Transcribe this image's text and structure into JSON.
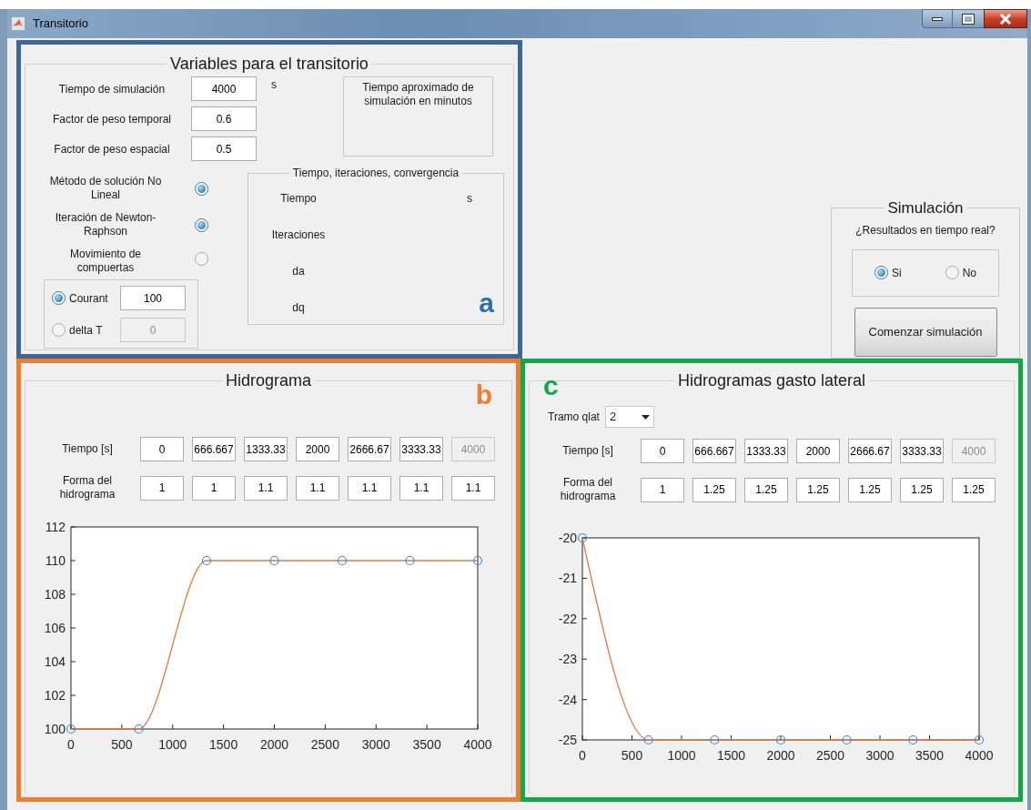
{
  "window": {
    "title": "Transitorio"
  },
  "variables_panel": {
    "title": "Variables para el transitorio",
    "annotation": {
      "letter": "a",
      "color": "#2f6ea8"
    },
    "fields": [
      {
        "label": "Tiempo de simulación",
        "value": "4000",
        "unit": "s"
      },
      {
        "label": "Factor de peso temporal",
        "value": "0.6"
      },
      {
        "label": "Factor de peso espacial",
        "value": "0.5"
      }
    ],
    "approx_time_box": {
      "text": "Tiempo aproximado de simulación en minutos"
    },
    "options": [
      {
        "label": "Método de solución No Lineal",
        "checked": true
      },
      {
        "label": "Iteración de Newton-Raphson",
        "checked": true
      },
      {
        "label": "Movimiento de compuertas",
        "checked": false
      }
    ],
    "step_group": [
      {
        "label": "Courant",
        "selected": true,
        "value": "100",
        "disabled": false
      },
      {
        "label": "delta T",
        "selected": false,
        "value": "0",
        "disabled": true
      }
    ],
    "convergence": {
      "title": "Tiempo, iteraciones, convergencia",
      "rows": [
        {
          "label": "Tiempo",
          "unit": "s"
        },
        {
          "label": "Iteraciones"
        },
        {
          "label": "da"
        },
        {
          "label": "dq"
        }
      ]
    }
  },
  "simulation": {
    "title": "Simulación",
    "question": "¿Resultados en tiempo real?",
    "options": [
      {
        "label": "Si",
        "selected": true
      },
      {
        "label": "No",
        "selected": false
      }
    ],
    "start_button": "Comenzar simulación"
  },
  "hydrograph": {
    "title": "Hidrograma",
    "annotation": {
      "letter": "b",
      "color": "#ed7d31"
    },
    "time_row": {
      "label": "Tiempo [s]",
      "cells": [
        {
          "value": "0",
          "disabled": false
        },
        {
          "value": "666.667",
          "disabled": false
        },
        {
          "value": "1333.33",
          "disabled": false
        },
        {
          "value": "2000",
          "disabled": false
        },
        {
          "value": "2666.67",
          "disabled": false
        },
        {
          "value": "3333.33",
          "disabled": false
        },
        {
          "value": "4000",
          "disabled": true
        }
      ]
    },
    "shape_row": {
      "label": "Forma del hidrograma",
      "cells": [
        {
          "value": "1",
          "disabled": false
        },
        {
          "value": "1",
          "disabled": false
        },
        {
          "value": "1.1",
          "disabled": false
        },
        {
          "value": "1.1",
          "disabled": false
        },
        {
          "value": "1.1",
          "disabled": false
        },
        {
          "value": "1.1",
          "disabled": false
        },
        {
          "value": "1.1",
          "disabled": false
        }
      ]
    },
    "chart_data": {
      "type": "line",
      "x": [
        0,
        666.667,
        1333.33,
        2000,
        2666.67,
        3333.33,
        4000
      ],
      "series": [
        {
          "color": "#e07b45",
          "marker": "o",
          "values": [
            100,
            100,
            110,
            110,
            110,
            110,
            110
          ]
        }
      ],
      "xlim": [
        0,
        4000
      ],
      "ylim": [
        100,
        112
      ],
      "xticks": [
        0,
        500,
        1000,
        1500,
        2000,
        2500,
        3000,
        3500,
        4000
      ],
      "yticks": [
        100,
        102,
        104,
        106,
        108,
        110,
        112
      ]
    }
  },
  "lateral_hydrograph": {
    "title": "Hidrogramas gasto lateral",
    "annotation": {
      "letter": "c",
      "color": "#13a64a"
    },
    "section_select": {
      "label": "Tramo qlat",
      "value": "2"
    },
    "time_row": {
      "label": "Tiempo [s]",
      "cells": [
        {
          "value": "0",
          "disabled": false
        },
        {
          "value": "666.667",
          "disabled": false
        },
        {
          "value": "1333.33",
          "disabled": false
        },
        {
          "value": "2000",
          "disabled": false
        },
        {
          "value": "2666.67",
          "disabled": false
        },
        {
          "value": "3333.33",
          "disabled": false
        },
        {
          "value": "4000",
          "disabled": true
        }
      ]
    },
    "shape_row": {
      "label": "Forma del hidrograma",
      "cells": [
        {
          "value": "1",
          "disabled": false
        },
        {
          "value": "1.25",
          "disabled": false
        },
        {
          "value": "1.25",
          "disabled": false
        },
        {
          "value": "1.25",
          "disabled": false
        },
        {
          "value": "1.25",
          "disabled": false
        },
        {
          "value": "1.25",
          "disabled": false
        },
        {
          "value": "1.25",
          "disabled": false
        }
      ]
    },
    "chart_data": {
      "type": "line",
      "x": [
        0,
        666.667,
        1333.33,
        2000,
        2666.67,
        3333.33,
        4000
      ],
      "series": [
        {
          "color": "#e07b45",
          "marker": "o",
          "values": [
            -20,
            -25,
            -25,
            -25,
            -25,
            -25,
            -25
          ]
        }
      ],
      "xlim": [
        0,
        4000
      ],
      "ylim": [
        -25,
        -20
      ],
      "xticks": [
        0,
        500,
        1000,
        1500,
        2000,
        2500,
        3000,
        3500,
        4000
      ],
      "yticks": [
        -25,
        -24,
        -23,
        -22,
        -21,
        -20
      ]
    }
  }
}
